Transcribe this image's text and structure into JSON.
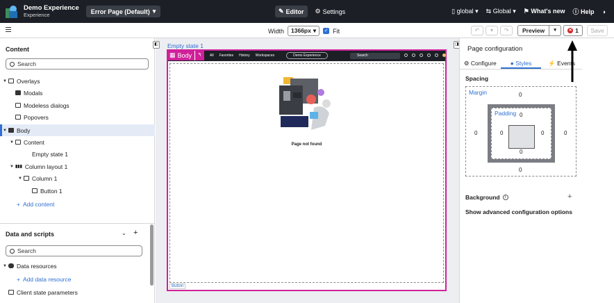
{
  "topbar": {
    "app_name": "Demo Experience",
    "app_sub": "Experience",
    "page_select": "Error Page (Default)",
    "editor": "Editor",
    "settings": "Settings",
    "scope1": "global",
    "scope2": "Global",
    "whats_new": "What's new",
    "help": "Help"
  },
  "subbar": {
    "width_label": "Width",
    "width_value": "1366px",
    "fit_label": "Fit",
    "preview": "Preview",
    "error_count": "1",
    "save": "Save"
  },
  "content_panel": {
    "title": "Content",
    "search_placeholder": "Search",
    "items": [
      {
        "label": "Overlays"
      },
      {
        "label": "Modals"
      },
      {
        "label": "Modeless dialogs"
      },
      {
        "label": "Popovers"
      },
      {
        "label": "Body"
      },
      {
        "label": "Content"
      },
      {
        "label": "Empty state 1"
      },
      {
        "label": "Column layout 1"
      },
      {
        "label": "Column 1"
      },
      {
        "label": "Button 1"
      }
    ],
    "add_content": "Add content"
  },
  "data_panel": {
    "title": "Data and scripts",
    "search_placeholder": "Search",
    "data_resources": "Data resources",
    "add_data_resource": "Add data resource",
    "client_state": "Client state parameters"
  },
  "canvas": {
    "empty_state_tag": "Empty state 1",
    "body_tag": "Body",
    "mini_nav": {
      "links": [
        "All",
        "Favorites",
        "History",
        "Workspaces"
      ],
      "pill": "Demo Experience",
      "search": "Search"
    },
    "page_not_found": "Page not found",
    "button_tag": "Button"
  },
  "config_panel": {
    "title": "Page configuration",
    "tabs": [
      "Configure",
      "Styles",
      "Events"
    ],
    "spacing": "Spacing",
    "margin_label": "Margin",
    "padding_label": "Padding",
    "margin": {
      "top": "0",
      "right": "0",
      "bottom": "0",
      "left": "0"
    },
    "padding": {
      "top": "0",
      "right": "0",
      "bottom": "0",
      "left": "0"
    },
    "background": "Background",
    "advanced": "Show advanced configuration options"
  }
}
